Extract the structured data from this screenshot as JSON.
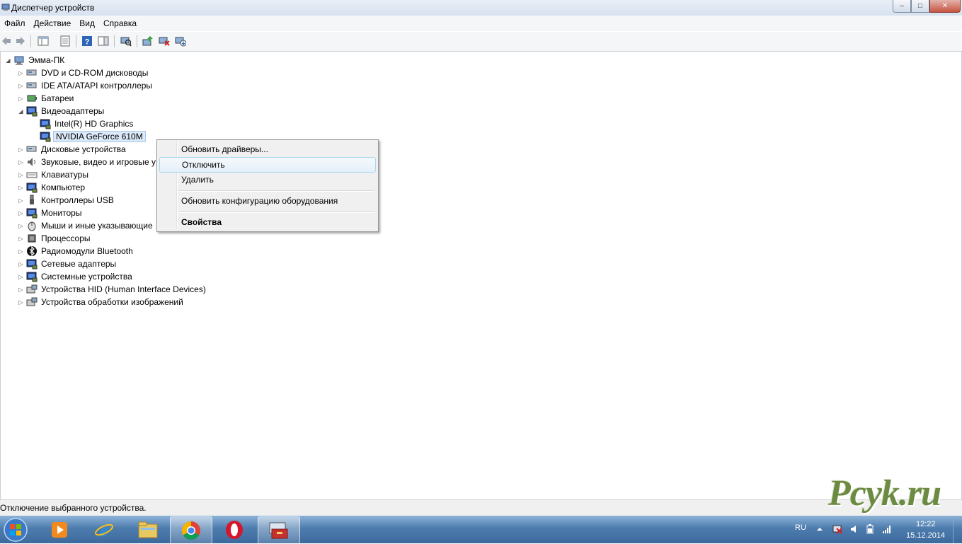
{
  "window": {
    "title": "Диспетчер устройств",
    "buttons": {
      "minimize": "–",
      "maximize": "□",
      "close": "✕"
    }
  },
  "menu": [
    "Файл",
    "Действие",
    "Вид",
    "Справка"
  ],
  "tree": {
    "root": "Эмма-ПК",
    "items": [
      {
        "label": "DVD и CD-ROM дисководы",
        "icon": "dvd-drive-icon",
        "expanded": false
      },
      {
        "label": "IDE ATA/ATAPI контроллеры",
        "icon": "ide-controller-icon",
        "expanded": false
      },
      {
        "label": "Батареи",
        "icon": "battery-icon",
        "expanded": false
      },
      {
        "label": "Видеоадаптеры",
        "icon": "display-adapter-icon",
        "expanded": true,
        "children": [
          "Intel(R) HD Graphics",
          "NVIDIA GeForce 610M"
        ]
      },
      {
        "label": "Дисковые устройства",
        "icon": "disk-drive-icon",
        "expanded": false
      },
      {
        "label": "Звуковые, видео и игровые у",
        "icon": "sound-icon",
        "expanded": false
      },
      {
        "label": "Клавиатуры",
        "icon": "keyboard-icon",
        "expanded": false
      },
      {
        "label": "Компьютер",
        "icon": "computer-icon",
        "expanded": false
      },
      {
        "label": "Контроллеры USB",
        "icon": "usb-icon",
        "expanded": false
      },
      {
        "label": "Мониторы",
        "icon": "monitor-icon",
        "expanded": false
      },
      {
        "label": "Мыши и иные указывающие",
        "icon": "mouse-icon",
        "expanded": false
      },
      {
        "label": "Процессоры",
        "icon": "processor-icon",
        "expanded": false
      },
      {
        "label": "Радиомодули Bluetooth",
        "icon": "bluetooth-icon",
        "expanded": false
      },
      {
        "label": "Сетевые адаптеры",
        "icon": "network-adapter-icon",
        "expanded": false
      },
      {
        "label": "Системные устройства",
        "icon": "system-device-icon",
        "expanded": false
      },
      {
        "label": "Устройства HID (Human Interface Devices)",
        "icon": "hid-icon",
        "expanded": false
      },
      {
        "label": "Устройства обработки изображений",
        "icon": "imaging-device-icon",
        "expanded": false
      }
    ],
    "selected": "NVIDIA GeForce 610M"
  },
  "context_menu": {
    "items": [
      {
        "label": "Обновить драйверы...",
        "bold": false,
        "hover": false
      },
      {
        "label": "Отключить",
        "bold": false,
        "hover": true
      },
      {
        "label": "Удалить",
        "bold": false,
        "hover": false
      },
      {
        "label": "Обновить конфигурацию оборудования",
        "bold": false,
        "hover": false
      },
      {
        "label": "Свойства",
        "bold": true,
        "hover": false
      }
    ]
  },
  "status": "Отключение выбранного устройства.",
  "watermark": "Pcyk.ru",
  "taskbar": {
    "apps": [
      "media-player-icon",
      "internet-explorer-icon",
      "explorer-folder-icon",
      "chrome-icon",
      "opera-icon",
      "device-manager-icon"
    ],
    "language": "RU",
    "time": "12:22",
    "date": "15.12.2014"
  },
  "colors": {
    "accent": "#3d6a9c",
    "selection": "#dbe9f9",
    "watermark": "#6c8a42"
  }
}
